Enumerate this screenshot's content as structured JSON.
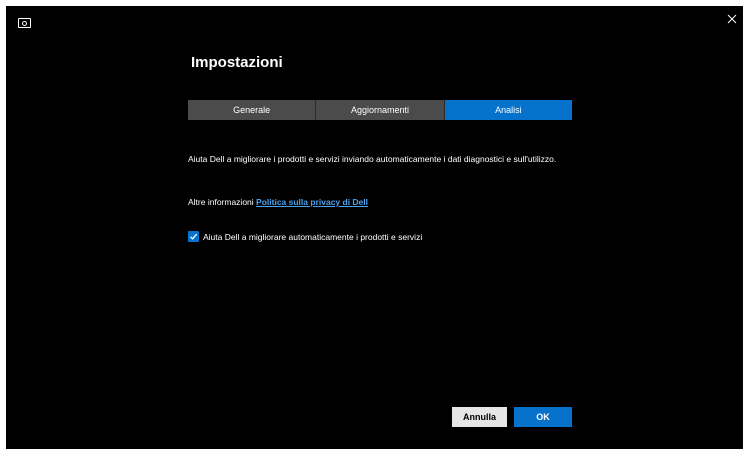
{
  "app": {
    "icon": "display-icon",
    "close_icon": "close-icon"
  },
  "settings": {
    "title": "Impostazioni",
    "tabs": [
      {
        "label": "Generale",
        "active": false
      },
      {
        "label": "Aggiornamenti",
        "active": false
      },
      {
        "label": "Analisi",
        "active": true
      }
    ],
    "description": "Aiuta Dell a migliorare i prodotti e servizi inviando automaticamente i dati diagnostici e sull'utilizzo.",
    "more_info_label": "Altre informazioni",
    "privacy_link": "Politica sulla privacy di Dell",
    "checkbox": {
      "label": "Aiuta Dell a migliorare automaticamente i prodotti e servizi",
      "checked": true
    },
    "cancel_label": "Annulla",
    "ok_label": "OK"
  },
  "colors": {
    "accent": "#0672cb",
    "link": "#4aa3f0",
    "tab_inactive": "#4b4b4b",
    "background": "#000000"
  }
}
